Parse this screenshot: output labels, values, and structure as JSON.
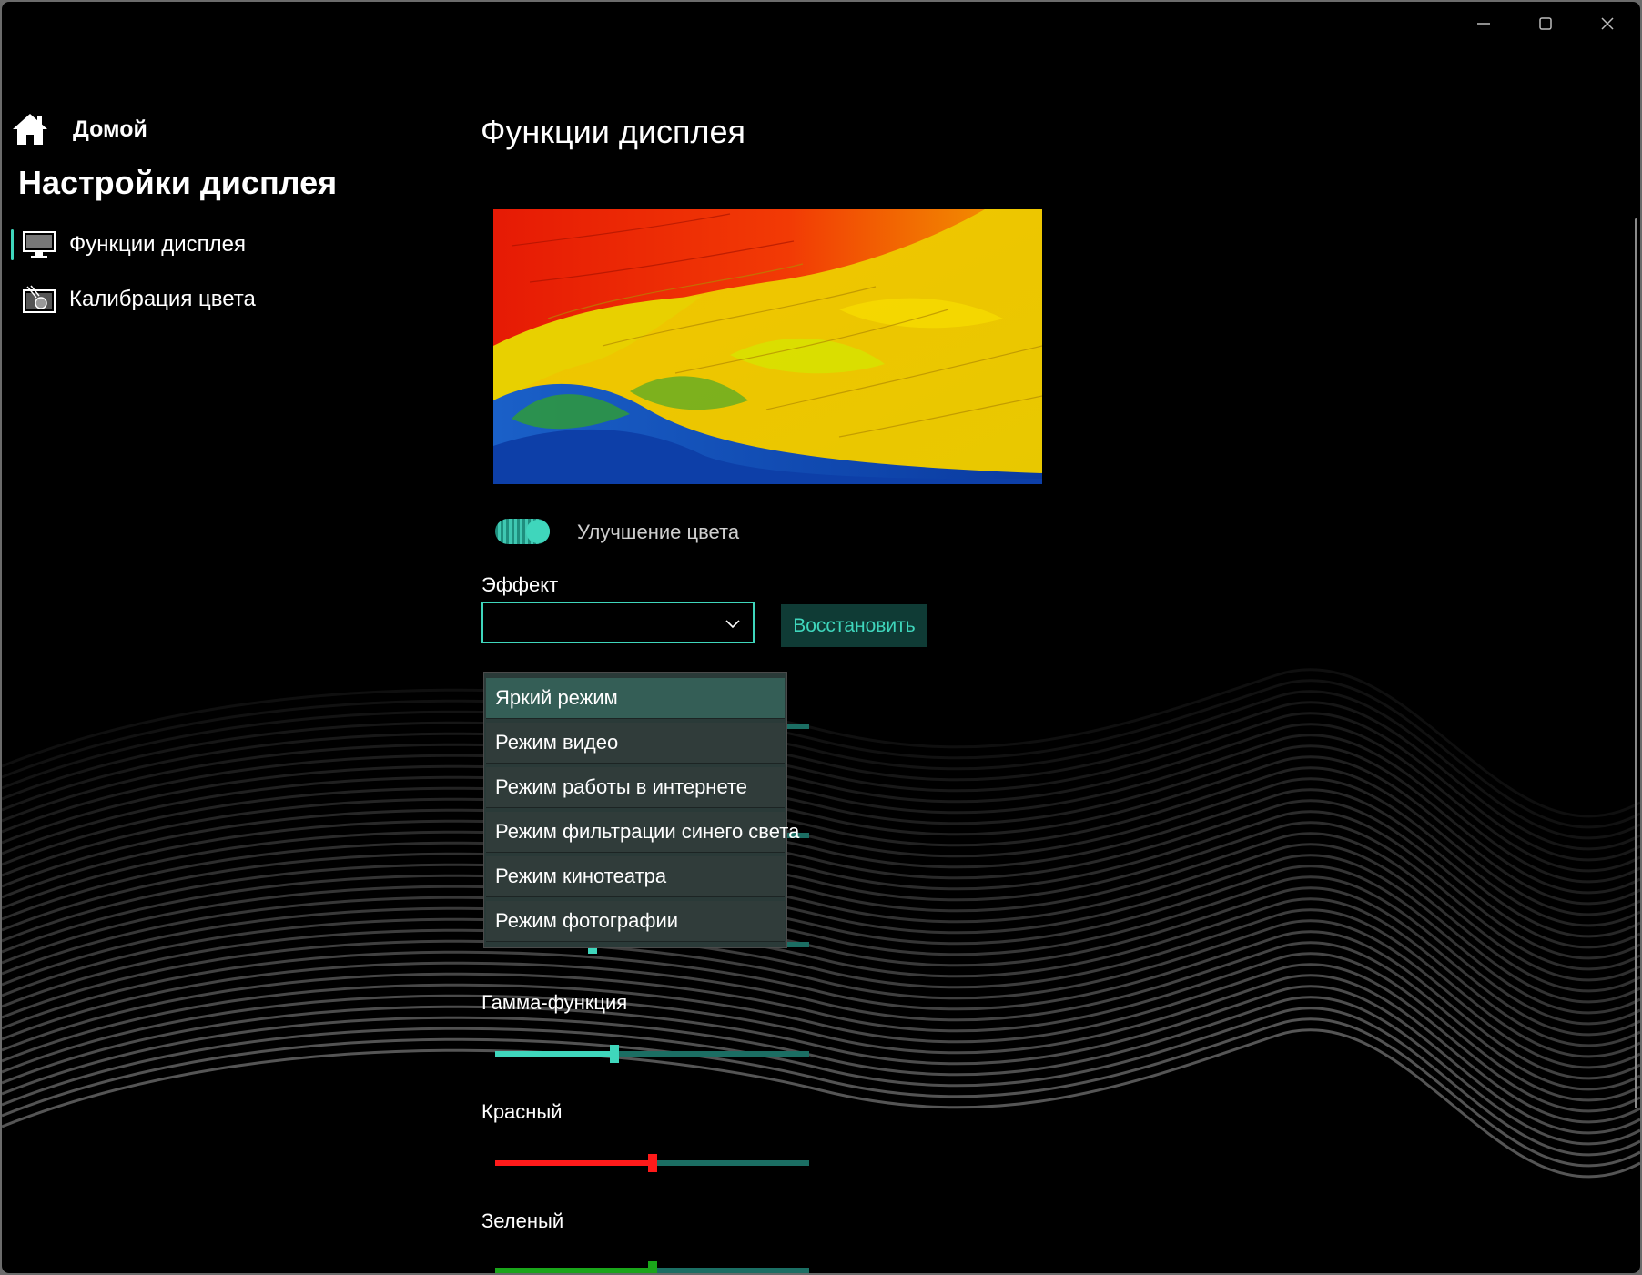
{
  "window": {
    "controls": [
      "minimize-icon",
      "maximize-icon",
      "close-icon"
    ]
  },
  "nav": {
    "home_label": "Домой",
    "title": "Настройки дисплея",
    "items": [
      {
        "label": "Функции дисплея",
        "icon": "monitor-icon",
        "selected": true
      },
      {
        "label": "Калибрация цвета",
        "icon": "calibration-icon",
        "selected": false
      }
    ]
  },
  "main": {
    "title": "Функции дисплея",
    "preview_image": "parrot-feathers-image",
    "color_enhance": {
      "label": "Улучшение цвета",
      "on": true
    },
    "effect": {
      "label": "Эффект",
      "value": "",
      "options": [
        "Яркий режим",
        "Режим видео",
        "Режим работы в интернете",
        "Режим фильтрации синего света",
        "Режим кинотеатра",
        "Режим фотографии"
      ],
      "highlighted": "Яркий режим"
    },
    "restore_label": "Восстановить",
    "sliders": {
      "gamma": {
        "label": "Гамма-функция",
        "value": 0.38
      },
      "red": {
        "label": "Красный",
        "value": 0.5
      },
      "green": {
        "label": "Зеленый",
        "value": 0.5
      },
      "hidden_contrast_value": 0.31
    }
  },
  "colors": {
    "accent": "#3fd6bc",
    "accent_dark": "#1b6e63",
    "red": "#ff1a1a",
    "green": "#1aa51a",
    "background": "#000000"
  }
}
